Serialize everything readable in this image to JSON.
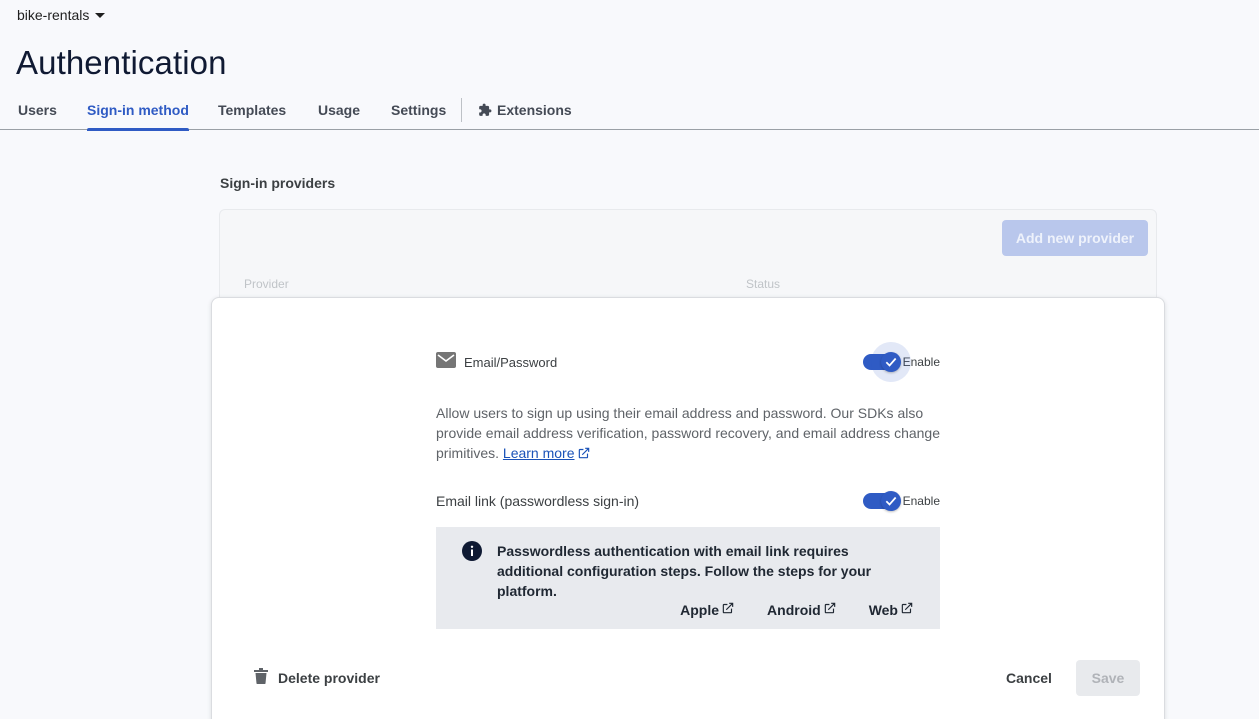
{
  "project": {
    "name": "bike-rentals",
    "icon": "caret-down-icon"
  },
  "page": {
    "title": "Authentication"
  },
  "tabs": [
    {
      "label": "Users"
    },
    {
      "label": "Sign-in method",
      "active": true
    },
    {
      "label": "Templates"
    },
    {
      "label": "Usage"
    },
    {
      "label": "Settings"
    },
    {
      "label": "Extensions",
      "icon": "puzzle-icon"
    }
  ],
  "providers": {
    "section_label": "Sign-in providers",
    "add_button": "Add new provider",
    "columns": [
      "Provider",
      "Status"
    ]
  },
  "modal": {
    "provider_name": "Email/Password",
    "provider_icon": "envelope-icon",
    "enable_label": "Enable",
    "email_password_enabled": true,
    "description": "Allow users to sign up using their email address and password. Our SDKs also provide email address verification, password recovery, and email address change primitives.",
    "learn_more": "Learn more",
    "email_link_label": "Email link (passwordless sign-in)",
    "email_link_enable_label": "Enable",
    "email_link_enabled": true,
    "info": {
      "icon": "info-icon",
      "text": "Passwordless authentication with email link requires additional configuration steps. Follow the steps for your platform.",
      "links": [
        "Apple",
        "Android",
        "Web"
      ]
    },
    "delete_label": "Delete provider",
    "delete_icon": "trash-icon",
    "cancel_label": "Cancel",
    "save_label": "Save"
  },
  "colors": {
    "accent": "#2f5bc4",
    "link": "#1a52b8",
    "title": "#101a33",
    "info_bg": "#e8eaee",
    "add_button_bg": "#b9c7ec"
  }
}
